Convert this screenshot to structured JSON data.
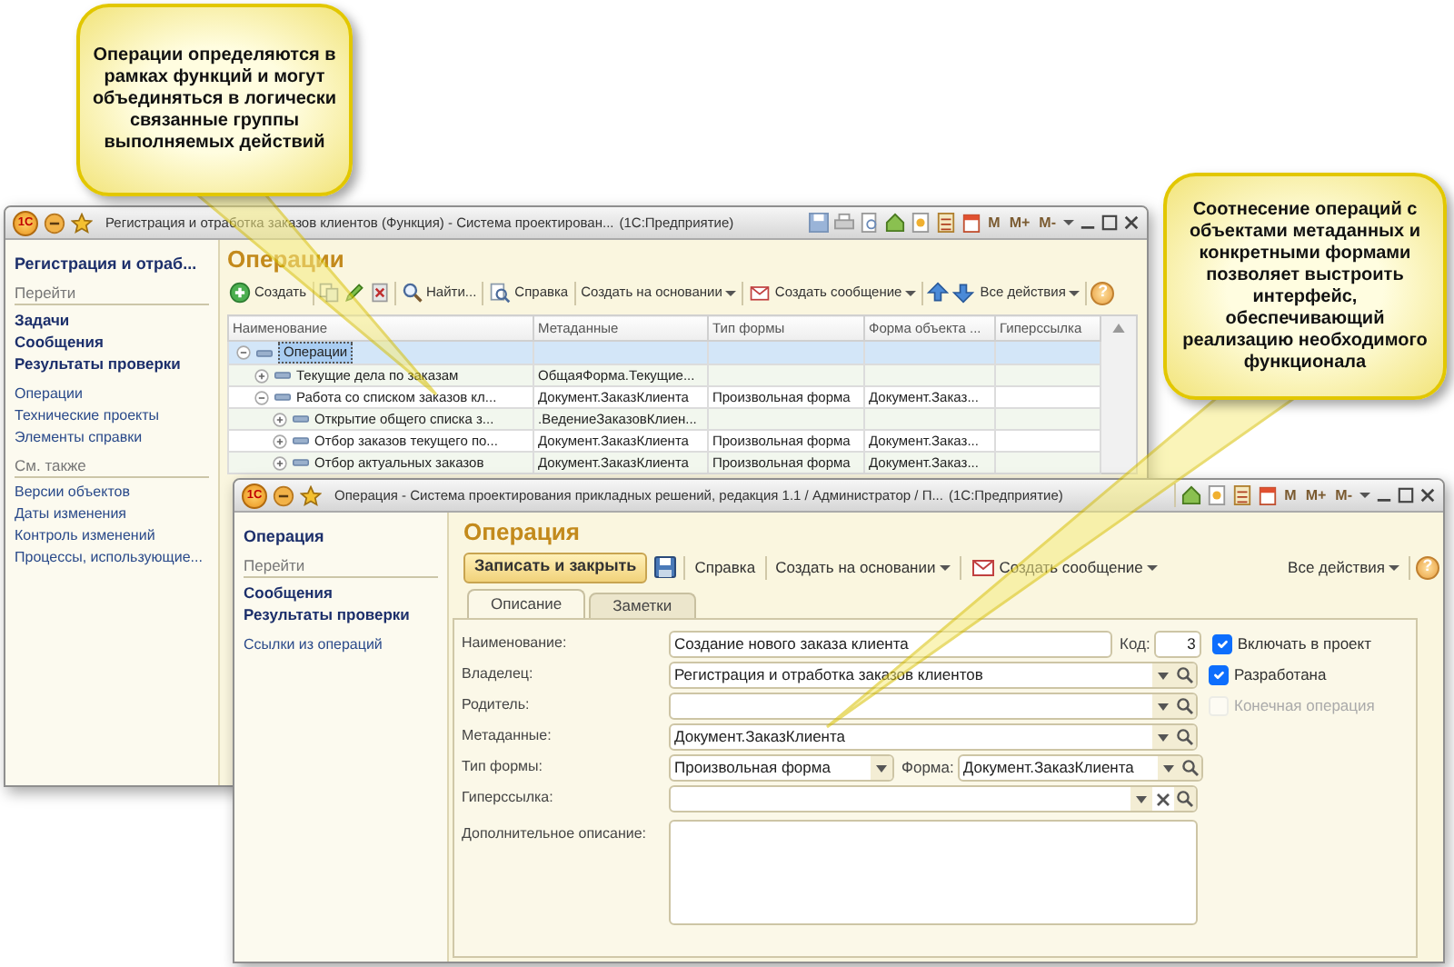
{
  "callouts": [
    {
      "text": "Операции определяются в рамках функций и могут объединяться в логически связанные группы выполняемых действий"
    },
    {
      "text": "Соотнесение операций с объектами метаданных и конкретными формами позволяет выстроить интерфейс, обеспечивающий реализацию необходимого функционала"
    }
  ],
  "back_window": {
    "kind": "list",
    "logo": "1С",
    "title": "Регистрация и отработка заказов клиентов (Функция) - Система проектирован...",
    "app": "(1С:Предприятие)",
    "memory_buttons": [
      "M",
      "M+",
      "M-"
    ],
    "sidebar": {
      "items": [
        {
          "kind": "heading",
          "label": "Регистрация и отраб..."
        },
        {
          "kind": "group",
          "label": "Перейти"
        },
        {
          "kind": "command",
          "label": "Задачи"
        },
        {
          "kind": "command",
          "label": "Сообщения"
        },
        {
          "kind": "command",
          "label": "Результаты проверки"
        },
        {
          "kind": "link",
          "label": "Операции"
        },
        {
          "kind": "link",
          "label": "Технические проекты"
        },
        {
          "kind": "link",
          "label": "Элементы справки"
        },
        {
          "kind": "group",
          "label": "См. также"
        },
        {
          "kind": "link",
          "label": "Версии объектов"
        },
        {
          "kind": "link",
          "label": "Даты изменения"
        },
        {
          "kind": "link",
          "label": "Контроль изменений"
        },
        {
          "kind": "link",
          "label": "Процессы, использующие..."
        }
      ]
    },
    "heading": "Операции",
    "toolbar": [
      {
        "kind": "create",
        "label": "Создать"
      },
      {
        "kind": "separator"
      },
      {
        "kind": "copy"
      },
      {
        "kind": "edit"
      },
      {
        "kind": "delete"
      },
      {
        "kind": "separator"
      },
      {
        "kind": "find",
        "label": "Найти..."
      },
      {
        "kind": "separator"
      },
      {
        "kind": "doc",
        "label": "Справка"
      },
      {
        "kind": "separator"
      },
      {
        "kind": "text",
        "label": "Создать на основании",
        "dropdown": true
      },
      {
        "kind": "separator"
      },
      {
        "kind": "message",
        "label": "Создать сообщение",
        "dropdown": true
      },
      {
        "kind": "separator"
      },
      {
        "kind": "up"
      },
      {
        "kind": "down"
      },
      {
        "kind": "text",
        "label": "Все действия",
        "dropdown": true
      },
      {
        "kind": "separator"
      },
      {
        "kind": "help",
        "label": "?"
      }
    ],
    "table": {
      "columns": [
        "Наименование",
        "Метаданные",
        "Тип формы",
        "Форма объекта ...",
        "Гиперссылка"
      ],
      "rows": [
        {
          "name": "Операции",
          "selected": true,
          "expanded": true,
          "children": [
            {
              "name": "Текущие дела по заказам",
              "metadata": "ОбщаяФорма.Текущие...",
              "selected": false,
              "expanded": false
            },
            {
              "name": "Работа со списком заказов кл...",
              "metadata": "Документ.ЗаказКлиента",
              "form_type": "Произвольная форма",
              "object_form": "Документ.Заказ...",
              "selected": false,
              "expanded": true,
              "children": [
                {
                  "name": "Открытие общего списка з...",
                  "metadata": ".ВедениеЗаказовКлиен...",
                  "selected": false,
                  "expanded": false
                },
                {
                  "name": "Отбор заказов текущего по...",
                  "metadata": "Документ.ЗаказКлиента",
                  "form_type": "Произвольная форма",
                  "object_form": "Документ.Заказ...",
                  "selected": false,
                  "expanded": false
                },
                {
                  "name": "Отбор актуальных заказов",
                  "metadata": "Документ.ЗаказКлиента",
                  "form_type": "Произвольная форма",
                  "object_form": "Документ.Заказ...",
                  "selected": false,
                  "expanded": false
                }
              ]
            }
          ]
        }
      ]
    }
  },
  "front_window": {
    "kind": "form",
    "logo": "1С",
    "title": "Операция - Система проектирования прикладных решений, редакция 1.1 / Администратор / П...",
    "app": "(1С:Предприятие)",
    "memory_buttons": [
      "M",
      "M+",
      "M-"
    ],
    "sidebar": {
      "items": [
        {
          "kind": "heading",
          "label": "Операция"
        },
        {
          "kind": "group",
          "label": "Перейти"
        },
        {
          "kind": "command",
          "label": "Сообщения"
        },
        {
          "kind": "command",
          "label": "Результаты проверки"
        },
        {
          "kind": "link",
          "label": "Ссылки из операций"
        }
      ]
    },
    "heading": "Операция",
    "toolbar": [
      {
        "kind": "primary",
        "label": "Записать и закрыть"
      },
      {
        "kind": "save"
      },
      {
        "kind": "separator"
      },
      {
        "kind": "text",
        "label": "Справка"
      },
      {
        "kind": "separator"
      },
      {
        "kind": "text",
        "label": "Создать на основании",
        "dropdown": true
      },
      {
        "kind": "separator"
      },
      {
        "kind": "message",
        "label": "Создать сообщение",
        "dropdown": true
      },
      {
        "kind": "spacer"
      },
      {
        "kind": "text",
        "label": "Все действия",
        "dropdown": true
      },
      {
        "kind": "separator"
      },
      {
        "kind": "help",
        "label": "?"
      }
    ],
    "tabs": [
      {
        "label": "Описание",
        "selected": true
      },
      {
        "label": "Заметки",
        "selected": false
      }
    ],
    "form": {
      "rows": [
        {
          "label": "Наименование:",
          "field": {
            "kind": "text",
            "value": "Создание нового заказа клиента"
          },
          "extra": {
            "kind": "code",
            "label": "Код:",
            "value": "3"
          },
          "checkbox": {
            "label": "Включать в проект",
            "checked": true,
            "disabled": false
          }
        },
        {
          "label": "Владелец:",
          "field": {
            "kind": "lookup",
            "value": "Регистрация и отработка заказов клиентов"
          },
          "checkbox": {
            "label": "Разработана",
            "checked": true,
            "disabled": false
          }
        },
        {
          "label": "Родитель:",
          "field": {
            "kind": "lookup"
          },
          "checkbox": {
            "label": "Конечная операция",
            "checked": false,
            "disabled": true
          }
        },
        {
          "label": "Метаданные:",
          "field": {
            "kind": "lookup",
            "value": "Документ.ЗаказКлиента"
          }
        },
        {
          "label": "Тип формы:",
          "field": {
            "kind": "choice",
            "value": "Произвольная форма"
          },
          "extra": {
            "kind": "lookup",
            "label": "Форма:",
            "value": "Документ.ЗаказКлиента"
          }
        },
        {
          "label": "Гиперссылка:",
          "field": {
            "kind": "lookup-clear"
          }
        },
        {
          "label": "Дополнительное описание:",
          "field": {
            "kind": "textarea"
          }
        }
      ]
    }
  }
}
